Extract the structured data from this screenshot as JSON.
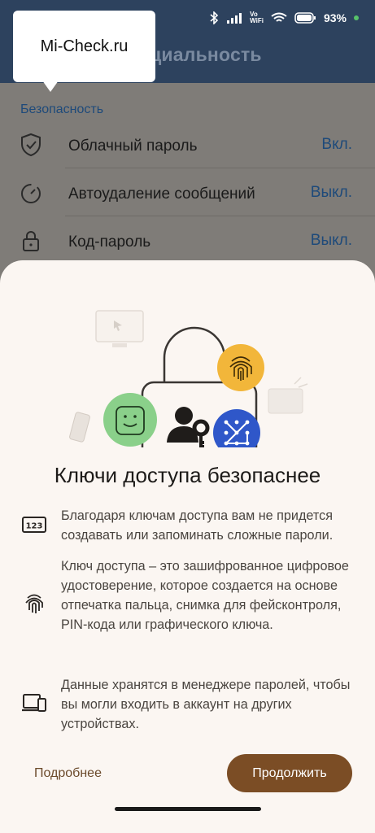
{
  "background_screen": {
    "header_title": "нциальность",
    "section_label": "Безопасность",
    "rows": [
      {
        "label": "Облачный пароль",
        "value": "Вкл.",
        "icon": "shield-check-icon"
      },
      {
        "label": "Автоудаление сообщений",
        "value": "Выкл.",
        "icon": "timer-icon"
      },
      {
        "label": "Код-пароль",
        "value": "Выкл.",
        "icon": "lock-icon"
      }
    ]
  },
  "status_bar": {
    "network_label_top": "Vo",
    "network_label_bottom": "WiFi",
    "battery": "93%"
  },
  "watermark": {
    "text": "Mi-Check.ru"
  },
  "sheet": {
    "title": "Ключи доступа безопаснее",
    "features": [
      {
        "icon": "keypad-123-icon",
        "icon_text": "123",
        "text": "Благодаря ключам доступа вам не придется создавать или запоминать сложные пароли."
      },
      {
        "icon": "fingerprint-icon",
        "text": "Ключ доступа – это зашифрованное цифровое удостоверение, которое создается на основе отпечатка пальца, снимка для фейсконтроля, PIN-кода или графического ключа."
      },
      {
        "icon": "devices-icon",
        "text": "Данные хранятся в менеджере паролей, чтобы вы могли входить в аккаунт на других устройствах."
      }
    ],
    "more_label": "Подробнее",
    "continue_label": "Продолжить"
  },
  "colors": {
    "accent_brown": "#7b4d25",
    "sheet_bg": "#fbf6f2",
    "link_blue": "#1e4a7a"
  }
}
